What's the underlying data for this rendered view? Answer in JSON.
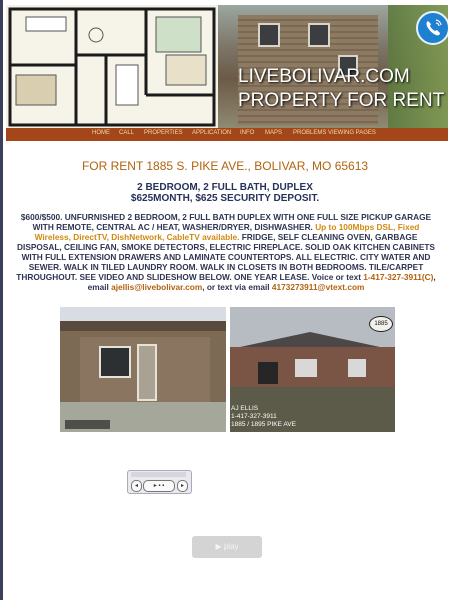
{
  "header": {
    "site_title_line1": "LIVEBOLIVAR.COM",
    "site_title_line2": "PROPERTY FOR RENT"
  },
  "nav": {
    "items": [
      "HOME",
      "CALL",
      "PROPERTIES",
      "APPLICATION",
      "INFO",
      "MAPS",
      "PROBLEMS VIEWING PAGES"
    ]
  },
  "listing": {
    "heading": "FOR RENT 1885 S. PIKE AVE., BOLIVAR, MO 65613",
    "sub_line1": "2 BEDROOM, 2 FULL BATH, DUPLEX",
    "sub_line2": "$625MONTH, $625 SECURITY DEPOSIT.",
    "desc_part1": "$600/$500.  UNFURNISHED 2 BEDROOM, 2 FULL BATH DUPLEX WITH ONE FULL SIZE PICKUP GARAGE WITH REMOTE, CENTRAL AC / HEAT, WASHER/DRYER, DISHWASHER. ",
    "desc_highlight": "Up to 100Mbps DSL, Fixed Wireless, DirectTV, DishNetwork, CableTV available.",
    "desc_part2": " FRIDGE, SELF CLEANING OVEN, GARBAGE DISPOSAL, CEILING FAN, SMOKE DETECTORS, ELECTRIC FIREPLACE.  SOLID OAK KITCHEN CABINETS WITH FULL EXTENSION DRAWERS AND LAMINATE COUNTERTOPS.  ALL ELECTRIC.  CITY WATER AND SEWER.  WALK IN TILED LAUNDRY ROOM.  WALK IN CLOSETS IN BOTH BEDROOMS.    TILE/CARPET THROUGHOUT.  SEE VIDEO AND SLIDESHOW BELOW.     ONE YEAR LEASE.  Voice or text ",
    "phone_link": "1-417-327-3911(C)",
    "email_text": ", email ",
    "email_link": "ajellis@livebolivar.com",
    "text_via": ", or text via email ",
    "text_email_link": "4173273911@vtext.com"
  },
  "photos": {
    "caption_name": "AJ ELLIS",
    "caption_phone": "1-417-327-3911",
    "caption_addr": "1885 / 1895 PIKE AVE",
    "sign_number": "1885"
  },
  "player": {
    "rewind": "◂",
    "play": "▸ ▪ ▪",
    "forward": "▸"
  },
  "video": {
    "play_label": "▶ play"
  }
}
